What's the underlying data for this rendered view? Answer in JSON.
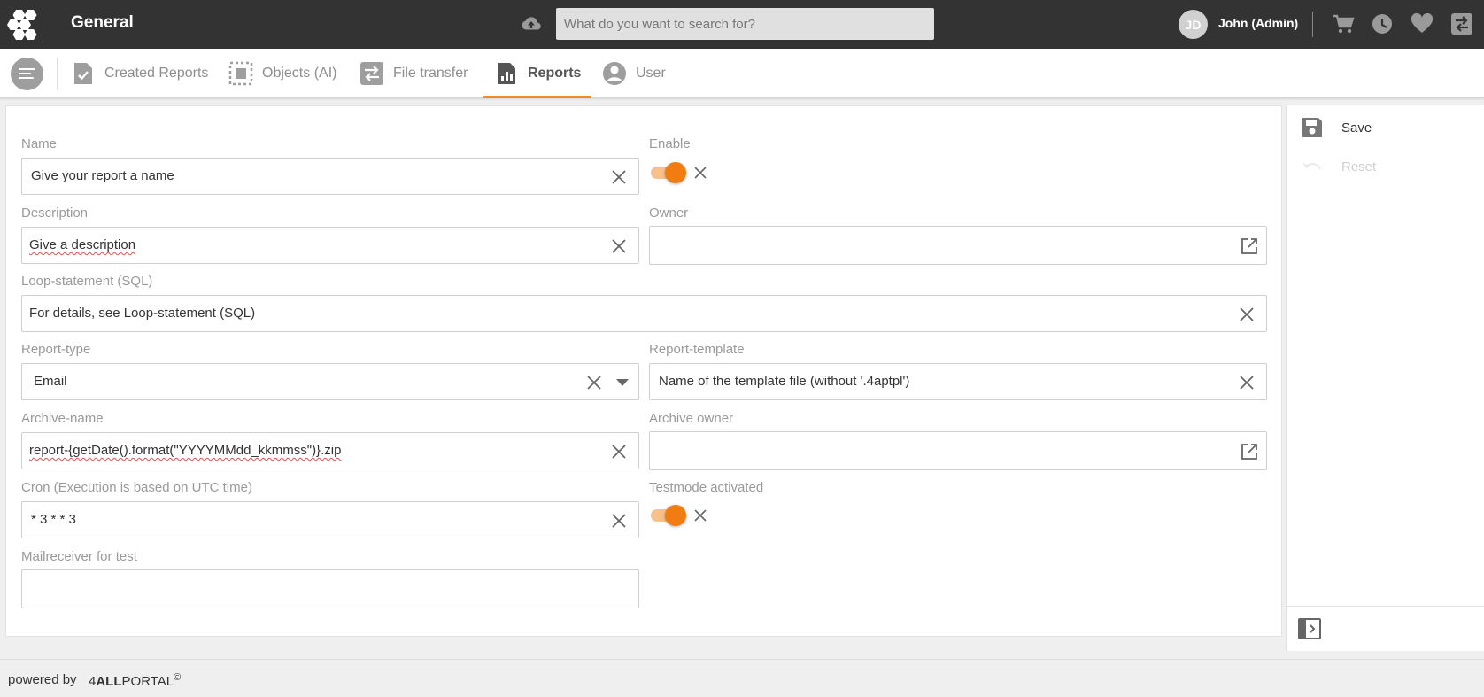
{
  "header": {
    "app_title": "General",
    "search_placeholder": "What do you want to search for?",
    "user_initials": "JD",
    "user_name": "John (Admin)",
    "icons": [
      "upload-icon",
      "cart-icon",
      "history-icon",
      "heart-icon",
      "swap-icon"
    ]
  },
  "nav": {
    "tabs": [
      {
        "label": "Created Reports",
        "icon": "report-check-icon",
        "active": false
      },
      {
        "label": "Objects (AI)",
        "icon": "objects-selection-icon",
        "active": false
      },
      {
        "label": "File transfer",
        "icon": "file-transfer-icon",
        "active": false
      },
      {
        "label": "Reports",
        "icon": "reports-chart-icon",
        "active": true
      },
      {
        "label": "User",
        "icon": "user-icon",
        "active": false
      }
    ]
  },
  "form": {
    "name": {
      "label": "Name",
      "value": "Give your report a name"
    },
    "enable": {
      "label": "Enable",
      "on": true
    },
    "description": {
      "label": "Description",
      "value": "Give a description"
    },
    "owner": {
      "label": "Owner",
      "value": ""
    },
    "loop": {
      "label": "Loop-statement (SQL)",
      "value": "For details, see Loop-statement (SQL)"
    },
    "report_type": {
      "label": "Report-type",
      "value": "Email"
    },
    "report_template": {
      "label": "Report-template",
      "value": "Name of the template file (without '.4aptpl')"
    },
    "archive_name": {
      "label": "Archive-name",
      "value": "report-{getDate().format(\"YYYYMMdd_kkmmss\")}.zip"
    },
    "archive_owner": {
      "label": "Archive owner",
      "value": ""
    },
    "cron": {
      "label": "Cron (Execution is based on UTC time)",
      "value": "* 3 * * 3"
    },
    "testmode": {
      "label": "Testmode activated",
      "on": true
    },
    "mailreceiver": {
      "label": "Mailreceiver for test",
      "value": ""
    }
  },
  "side": {
    "save_label": "Save",
    "reset_label": "Reset"
  },
  "footer": {
    "powered_by": "powered by",
    "brand_prefix": "4",
    "brand_bold": "ALL",
    "brand_suffix": "PORTAL",
    "brand_mark": "©"
  },
  "colors": {
    "accent": "#f07c12",
    "topbar": "#333333",
    "toggle_track": "#f9c189"
  }
}
